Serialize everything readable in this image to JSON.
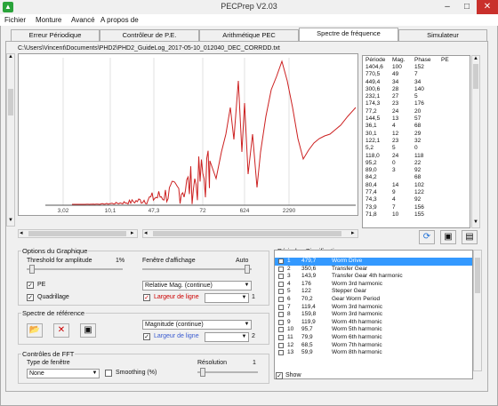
{
  "window": {
    "title": "PECPrep V2.03"
  },
  "menu": [
    "Fichier",
    "Monture",
    "Avancé",
    "A propos de"
  ],
  "tabs": [
    {
      "label": "Erreur Périodique"
    },
    {
      "label": "Contrôleur de P.E."
    },
    {
      "label": "Arithmétique PEC"
    },
    {
      "label": "Spectre de fréquence"
    },
    {
      "label": "Simulateur"
    }
  ],
  "file_path": "C:\\Users\\Vincent\\Documents\\PHD2\\PHD2_GuideLog_2017-05-10_012040_DEC_CORRDD.txt",
  "chart_data": {
    "type": "line",
    "x_tick_labels": [
      "3,02",
      "10,1",
      "47,3",
      "72",
      "624",
      "2290"
    ],
    "series": [
      {
        "color": "#cc2020"
      }
    ]
  },
  "periods_table": {
    "headers": [
      "Période",
      "Mag.",
      "Phase",
      "PE"
    ],
    "rows": [
      [
        "1404,6",
        "100",
        "152",
        ""
      ],
      [
        "770,5",
        "49",
        "7",
        ""
      ],
      [
        "449,4",
        "34",
        "34",
        ""
      ],
      [
        "300,6",
        "28",
        "140",
        ""
      ],
      [
        "232,1",
        "27",
        "5",
        ""
      ],
      [
        "174,3",
        "23",
        "176",
        ""
      ],
      [
        "77,2",
        "24",
        "20",
        ""
      ],
      [
        "144,5",
        "13",
        "57",
        ""
      ],
      [
        "36,1",
        "4",
        "68",
        ""
      ],
      [
        "30,1",
        "12",
        "29",
        ""
      ],
      [
        "122,1",
        "23",
        "32",
        ""
      ],
      [
        "5,2",
        "5",
        "0",
        ""
      ],
      [
        "118,0",
        "24",
        "118",
        ""
      ],
      [
        "95,2",
        "0",
        "22",
        ""
      ],
      [
        "89,0",
        "3",
        "92",
        ""
      ],
      [
        "84,2",
        "",
        "68",
        ""
      ],
      [
        "80,4",
        "14",
        "102",
        ""
      ],
      [
        "77,4",
        "9",
        "122",
        ""
      ],
      [
        "74,3",
        "4",
        "92",
        ""
      ],
      [
        "73,9",
        "7",
        "156",
        ""
      ],
      [
        "71,8",
        "10",
        "155",
        ""
      ]
    ]
  },
  "options": {
    "title": "Options du Graphique",
    "threshold_label": "Threshold for amplitude",
    "threshold_value": "1%",
    "window_label": "Fenêtre d'affichage",
    "window_value": "Auto",
    "pe_label": "PE",
    "pe_checked": true,
    "quadrillage_label": "Quadrillage",
    "quadrillage_checked": true,
    "mode_select": "Relative Mag. (continue)",
    "line_width_label": "Largeur de ligne",
    "line_width_value": "1"
  },
  "reference": {
    "title": "Spectre de référence",
    "mode_select": "Magnitude (continue)",
    "line_width_label": "Largeur de ligne",
    "line_width_value": "2"
  },
  "fft": {
    "title": "Contrôles de FFT",
    "window_label": "Type de fenêtre",
    "window_value": "None",
    "smooth_label": "Smoothing (%)",
    "resolution_label": "Résolution",
    "resolution_value": "1"
  },
  "significant": {
    "title": "Périodes Significatives",
    "rows": [
      [
        "1",
        "479,7",
        "Worm Drive"
      ],
      [
        "2",
        "350,6",
        "Transfer Gear"
      ],
      [
        "3",
        "143,9",
        "Transfer Gear 4th harmonic"
      ],
      [
        "4",
        "176",
        "Worm 3rd harmonic"
      ],
      [
        "5",
        "122",
        "Stepper Gear"
      ],
      [
        "6",
        "70,2",
        "Gear Worm Period"
      ],
      [
        "7",
        "119,4",
        "Worm 3rd harmonic"
      ],
      [
        "8",
        "159,8",
        "Worm 3rd harmonic"
      ],
      [
        "9",
        "119,9",
        "Worm 4th harmonic"
      ],
      [
        "10",
        "95,7",
        "Worm 5th harmonic"
      ],
      [
        "11",
        "79,9",
        "Worm 6th harmonic"
      ],
      [
        "12",
        "68,5",
        "Worm 7th harmonic"
      ],
      [
        "13",
        "59,9",
        "Worm 8th harmonic"
      ]
    ],
    "show_label": "Show"
  }
}
